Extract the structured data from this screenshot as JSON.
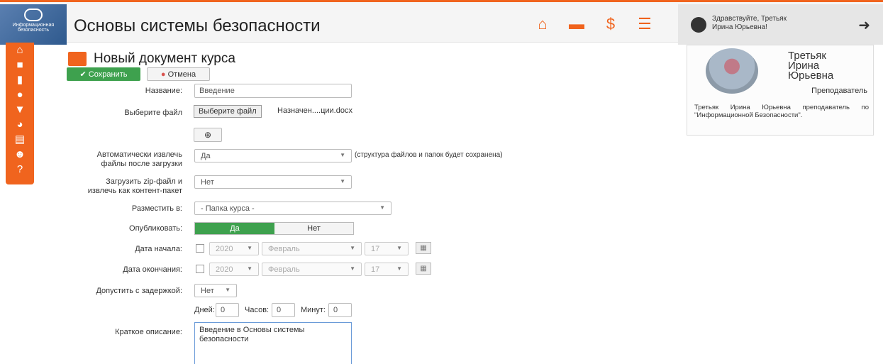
{
  "header": {
    "logo_text": "Информационная безопасность",
    "title": "Основы системы безопасности",
    "icons": [
      "home-icon",
      "monitor-icon",
      "hand-money-icon",
      "list-icon"
    ],
    "greeting": "Здравствуйте, Третьяк Ирина Юрьевна!",
    "accent": "#f0641e"
  },
  "sidebar": {
    "icons": [
      "home-icon",
      "folder-icon",
      "chart-icon",
      "shield-icon",
      "graduation-cap-icon",
      "pie-chart-icon",
      "inbox-icon",
      "users-icon",
      "help-icon"
    ]
  },
  "page": {
    "title": "Новый документ курса",
    "save_label": "Сохранить",
    "cancel_label": "Отмена"
  },
  "form": {
    "name_label": "Название:",
    "name_value": "Введение",
    "file_label": "Выберите файл",
    "file_button": "Выберите файл",
    "file_name": "Назначен....ции.docx",
    "extract_label": "Автоматически извлечь файлы после загрузки",
    "extract_value": "Да",
    "extract_hint": "(структура файлов и папок будет сохранена)",
    "zip_label": "Загрузить zip-файл и извлечь как контент-пакет",
    "zip_value": "Нет",
    "place_label": "Разместить в:",
    "place_value": "- Папка курса -",
    "publish_label": "Опубликовать:",
    "publish_yes": "Да",
    "publish_no": "Нет",
    "start_label": "Дата начала:",
    "end_label": "Дата окончания:",
    "year": "2020",
    "month": "Февраль",
    "day": "17",
    "delay_label": "Допустить с задержкой:",
    "delay_value": "Нет",
    "days_label": "Дней:",
    "days_value": "0",
    "hours_label": "Часов:",
    "hours_value": "0",
    "minutes_label": "Минут:",
    "minutes_value": "0",
    "desc_label": "Краткое описание:",
    "desc_value": "Введение в Основы системы безопасности"
  },
  "profile": {
    "name": "Третьяк Ирина Юрьевна",
    "role": "Преподаватель",
    "description": "Третьяк Ирина Юрьевна преподаватель по \"Информационной Безопасности\"."
  }
}
